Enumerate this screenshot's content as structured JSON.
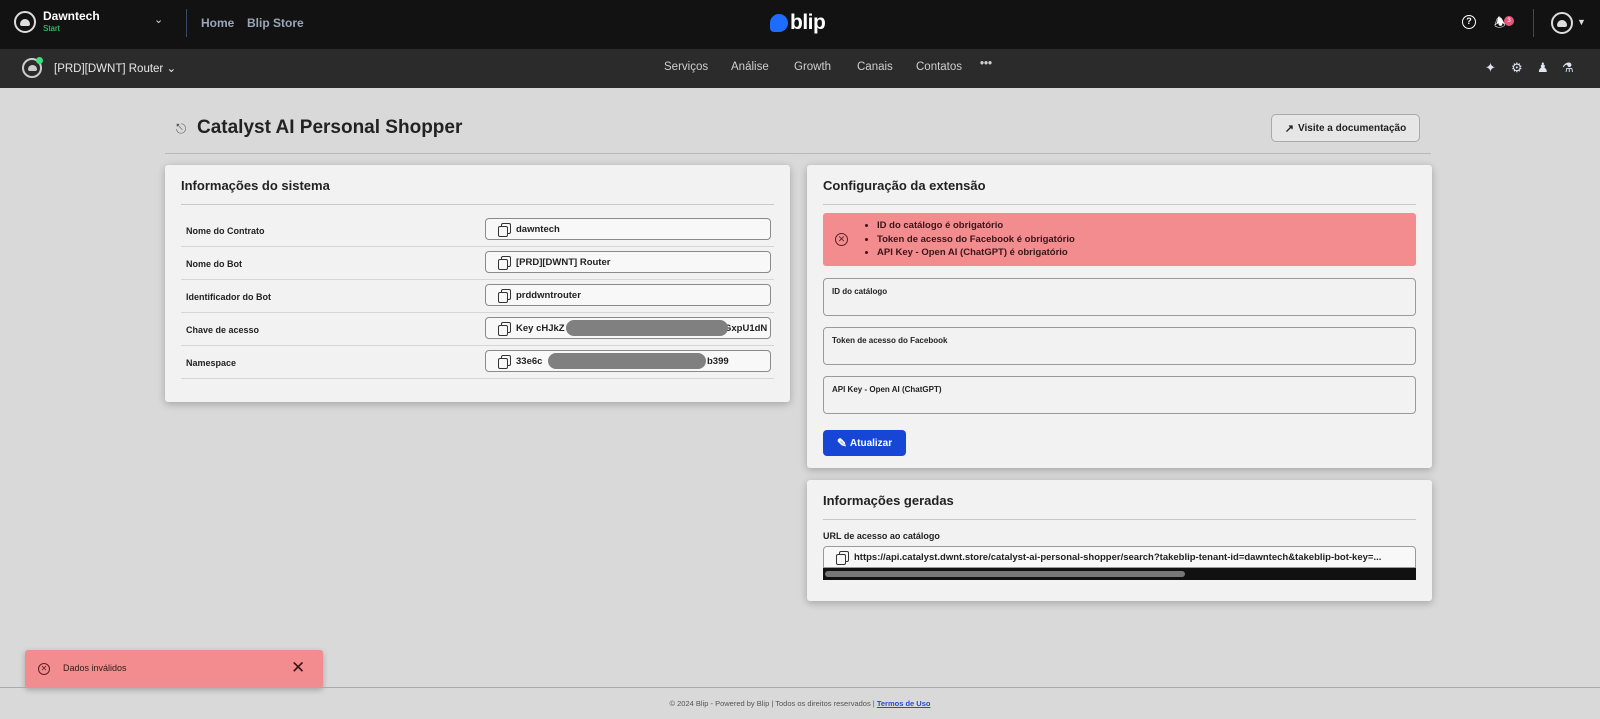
{
  "topbar": {
    "org_name": "Dawntech",
    "org_plan": "Start",
    "links": [
      "Home",
      "Blip Store"
    ],
    "brand": "blip",
    "notification_count": "3"
  },
  "subbar": {
    "bot_name": "[PRD][DWNT] Router",
    "nav": [
      "Serviços",
      "Análise",
      "Growth",
      "Canais",
      "Contatos",
      "•••"
    ]
  },
  "page": {
    "title": "Catalyst AI Personal Shopper",
    "doc_button": "Visite a documentação"
  },
  "system_info": {
    "title": "Informações do sistema",
    "rows": [
      {
        "label": "Nome do Contrato",
        "value": "dawntech"
      },
      {
        "label": "Nome do Bot",
        "value": "[PRD][DWNT] Router"
      },
      {
        "label": "Identificador do Bot",
        "value": "prddwntrouter"
      },
      {
        "label": "Chave de acesso",
        "value": "Key cHJkZ",
        "value_tail": "GxpU1dN"
      },
      {
        "label": "Namespace",
        "value": "33e6c",
        "value_tail": "b399"
      }
    ]
  },
  "config": {
    "title": "Configuração da extensão",
    "errors": [
      "ID do catálogo é obrigatório",
      "Token de acesso do Facebook é obrigatório",
      "API Key - Open AI (ChatGPT) é obrigatório"
    ],
    "fields": [
      {
        "label": "ID do catálogo",
        "value": ""
      },
      {
        "label": "Token de acesso do Facebook",
        "value": ""
      },
      {
        "label": "API Key - Open AI (ChatGPT)",
        "value": ""
      }
    ],
    "update_button": "Atualizar"
  },
  "generated": {
    "title": "Informações geradas",
    "url_label": "URL de acesso ao catálogo",
    "url": "https://api.catalyst.dwnt.store/catalyst-ai-personal-shopper/search?takeblip-tenant-id=dawntech&takeblip-bot-key=..."
  },
  "toast": {
    "message": "Dados inválidos",
    "color": "#f38c8f"
  },
  "footer": {
    "text": "© 2024 Blip - Powered by Blip | Todos os direitos reservados |",
    "link": "Termos de Uso"
  },
  "colors": {
    "accent": "#1746d6",
    "error": "#f38c8f",
    "online": "#3ee07c"
  }
}
